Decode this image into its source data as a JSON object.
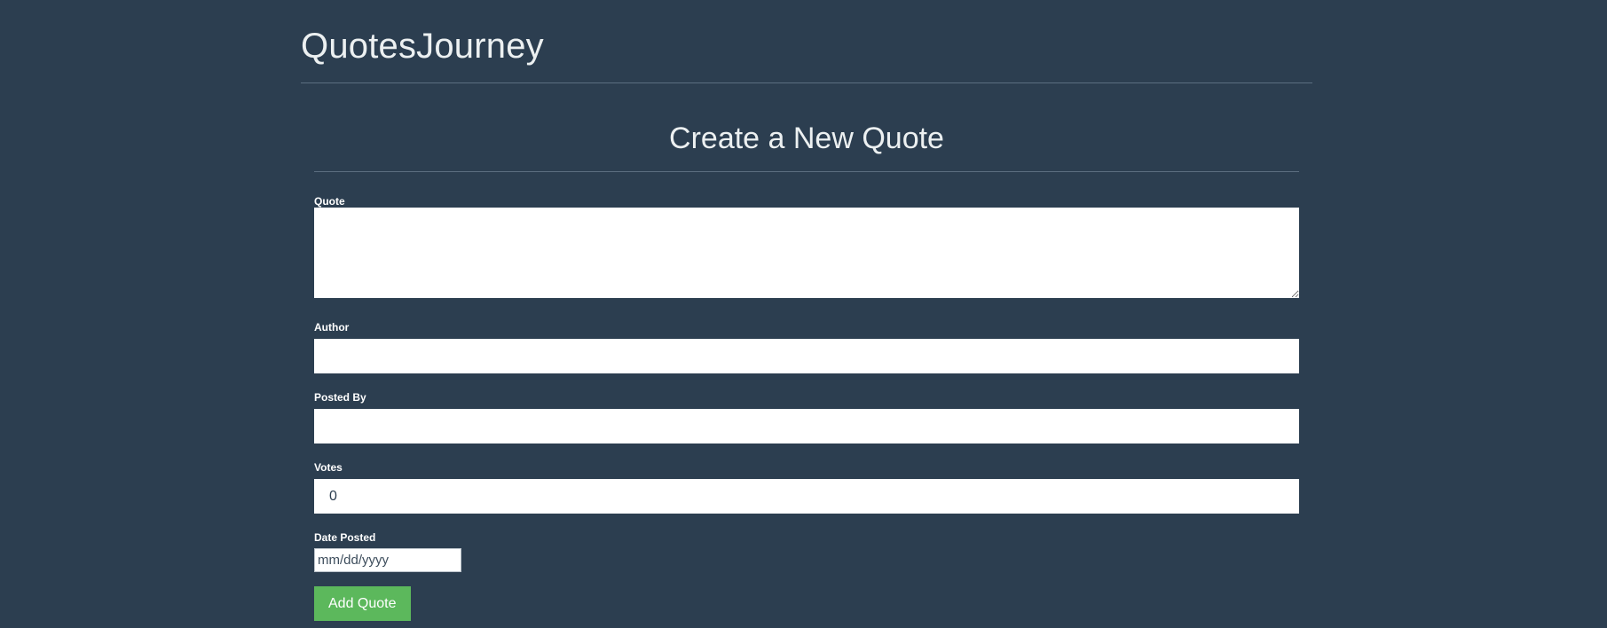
{
  "header": {
    "brand": "QuotesJourney"
  },
  "form": {
    "title": "Create a New Quote",
    "fields": {
      "quote": {
        "label": "Quote",
        "value": ""
      },
      "author": {
        "label": "Author",
        "value": ""
      },
      "posted_by": {
        "label": "Posted By",
        "value": ""
      },
      "votes": {
        "label": "Votes",
        "value": "0"
      },
      "date_posted": {
        "label": "Date Posted",
        "placeholder": "mm/dd/yyyy"
      }
    },
    "submit_label": "Add Quote"
  },
  "colors": {
    "background": "#2c3e50",
    "submit_button": "#5cb85c",
    "input_background": "#ffffff"
  }
}
